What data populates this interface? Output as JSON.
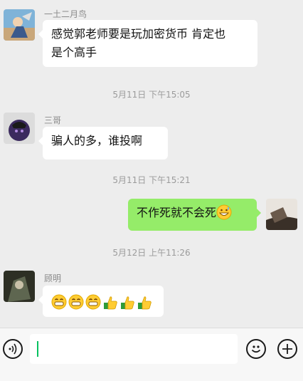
{
  "messages": [
    {
      "sender": "一土二月鸟",
      "text_line1": "感觉郭老师要是玩加密货币 肯定也",
      "text_line2": "是个高手"
    },
    {
      "sender": "三哥",
      "text": "骗人的多，谁投啊"
    },
    {
      "text": "不作死就不会死",
      "emoji": "grinning-sweat-emoji"
    },
    {
      "sender": "顾明",
      "emojis": [
        "grin-emoji",
        "grin-emoji",
        "grin-emoji",
        "thumbs-up-emoji",
        "thumbs-up-emoji",
        "thumbs-up-emoji"
      ]
    }
  ],
  "timestamps": [
    "5月11日 下午15:05",
    "5月11日 下午15:21",
    "5月12日 上午11:26"
  ],
  "input": {
    "value": ""
  },
  "icons": {
    "voice": "voice-icon",
    "emoji": "emoji-icon",
    "plus": "plus-icon"
  },
  "colors": {
    "background": "#ededed",
    "bubble_self": "#95ec69",
    "bubble_other": "#ffffff",
    "caret": "#07c160"
  }
}
